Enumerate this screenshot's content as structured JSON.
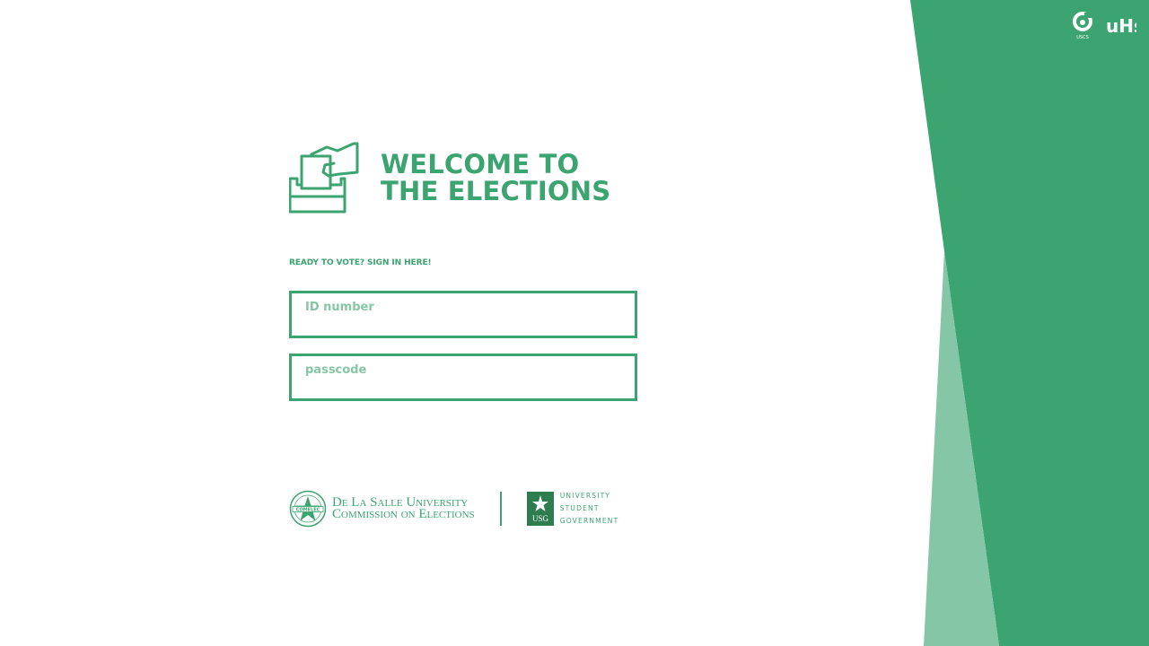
{
  "welcome": {
    "title_line1": "WELCOME TO",
    "title_line2": "THE ELECTIONS",
    "subtitle": "READY TO VOTE? SIGN IN HERE!"
  },
  "form": {
    "id_placeholder": "ID number",
    "id_value": "",
    "passcode_placeholder": "passcode",
    "passcode_value": ""
  },
  "footer": {
    "comelec_line1": "De La Salle University",
    "comelec_line2": "Commission on Elections",
    "usg_line1": "UNIVERSITY",
    "usg_line2": "STUDENT",
    "usg_line3": "GOVERNMENT"
  },
  "logos": {
    "top_right_1": "USCS",
    "top_right_2": "uHs",
    "seal_text": "COMELEC",
    "usg_mark": "USG"
  },
  "icons": {
    "ballot": "ballot-box-icon"
  },
  "colors": {
    "primary": "#3ca470",
    "accent_light": "#85c6a6",
    "placeholder": "#87c6a4",
    "background": "#ffffff"
  }
}
